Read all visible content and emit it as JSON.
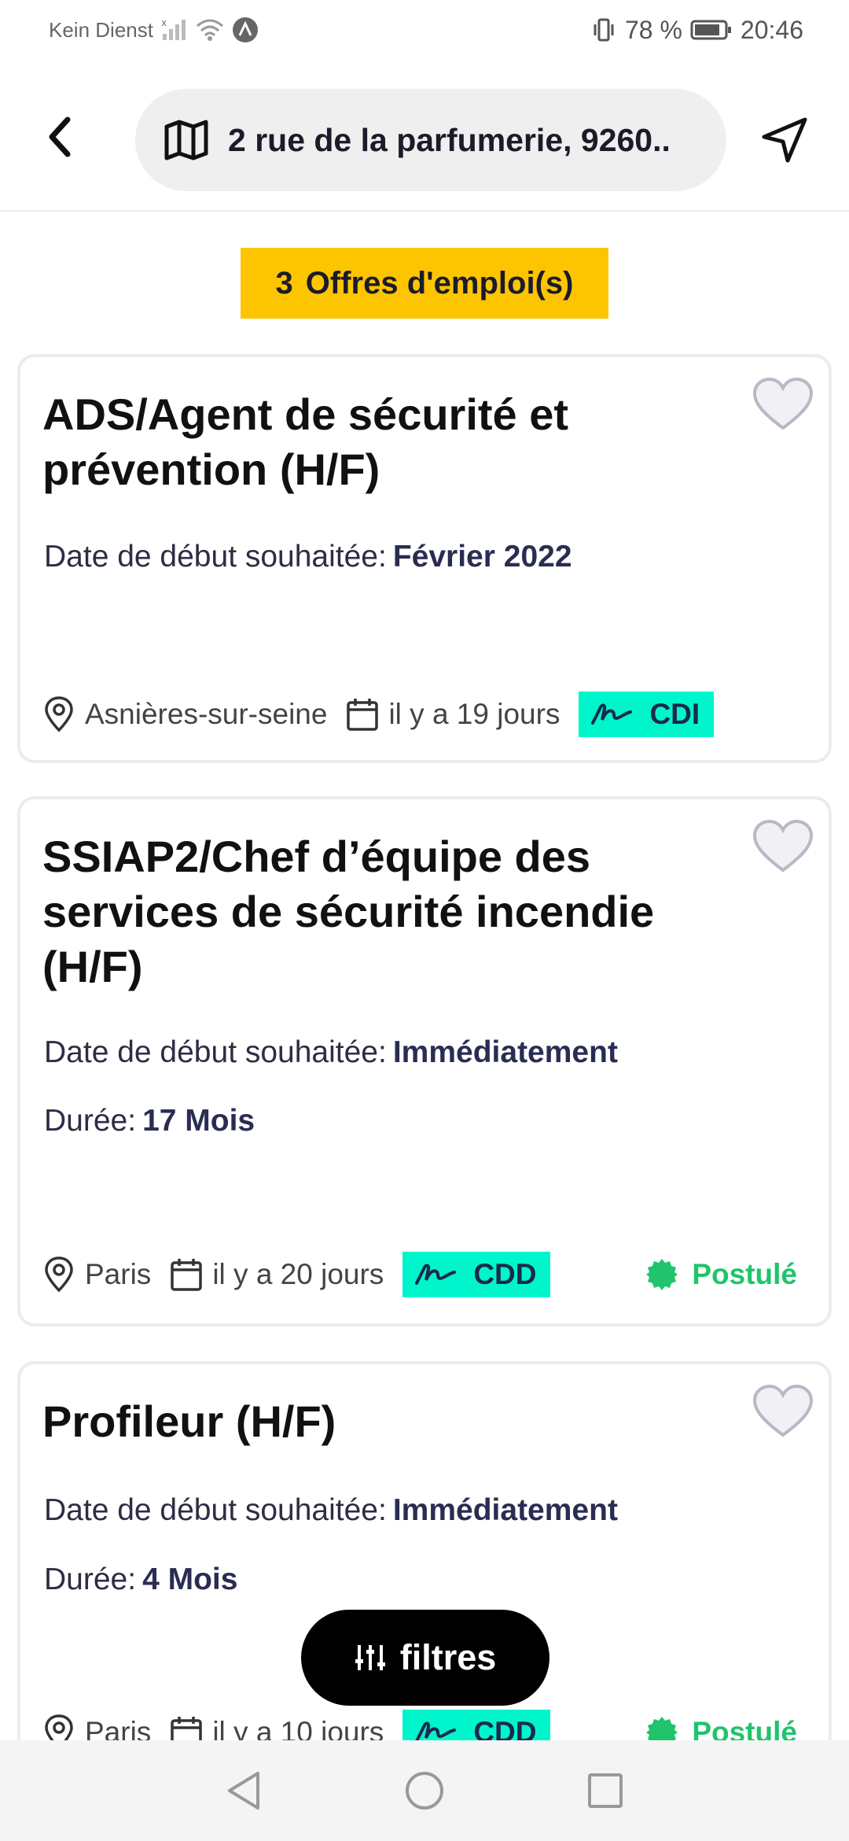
{
  "status_bar": {
    "carrier": "Kein Dienst",
    "battery": "78 %",
    "time": "20:46"
  },
  "header": {
    "address": "2 rue de la parfumerie, 9260.."
  },
  "results": {
    "count": "3",
    "label": "Offres d'emploi(s)"
  },
  "labels": {
    "start_date": "Date de début souhaitée:",
    "duration": "Durée:"
  },
  "jobs": [
    {
      "title": "ADS/Agent de sécurité et prévention (H/F)",
      "start_date": "Février 2022",
      "location": "Asnières-sur-seine",
      "posted": "il y a 19 jours",
      "contract": "CDI"
    },
    {
      "title": "SSIAP2/Chef d’équipe des services de sécurité incendie (H/F)",
      "start_date": "Immédiatement",
      "duration": "17 Mois",
      "location": "Paris",
      "posted": "il y a 20 jours",
      "contract": "CDD",
      "status": "Postulé"
    },
    {
      "title": "Profileur (H/F)",
      "start_date": "Immédiatement",
      "duration": "4 Mois",
      "location": "Paris",
      "posted": "il y a 10 jours",
      "contract": "CDD",
      "status": "Postulé"
    }
  ],
  "filter_button": "filtres",
  "colors": {
    "badge_yellow": "#fdc500",
    "contract_teal": "#00f5cc",
    "applied_green": "#20c46b"
  },
  "icons": [
    "back-arrow-icon",
    "map-icon",
    "navigation-arrow-icon",
    "heart-icon",
    "location-pin-icon",
    "calendar-icon",
    "signature-icon",
    "badge-check-icon",
    "sliders-icon"
  ]
}
